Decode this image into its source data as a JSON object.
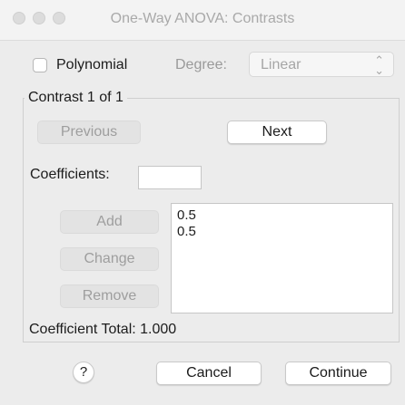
{
  "window": {
    "title": "One-Way ANOVA: Contrasts"
  },
  "polynomial": {
    "checkbox_label": "Polynomial",
    "checked": false,
    "degree_label": "Degree:",
    "degree_value": "Linear"
  },
  "contrast_group": {
    "legend": "Contrast 1 of 1",
    "previous_label": "Previous",
    "next_label": "Next",
    "coefficients_label": "Coefficients:",
    "coefficients_value": "",
    "add_label": "Add",
    "change_label": "Change",
    "remove_label": "Remove",
    "coefficient_list": [
      "0.5",
      "0.5"
    ],
    "total_label": "Coefficient Total:",
    "total_value": "1.000"
  },
  "footer": {
    "help_label": "?",
    "cancel_label": "Cancel",
    "continue_label": "Continue"
  }
}
